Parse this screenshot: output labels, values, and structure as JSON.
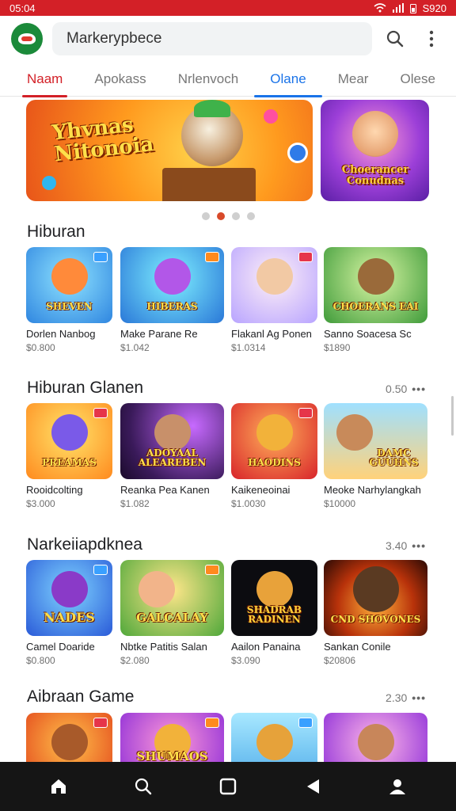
{
  "status": {
    "time": "05:04",
    "right": "S920"
  },
  "header": {
    "search_text": "Markerypbece"
  },
  "tabs": [
    "Naam",
    "Apokass",
    "Nrlenvoch",
    "Olane",
    "Mear",
    "Olese"
  ],
  "banners": {
    "main_text": "Yhvnas Nitonoia",
    "side_text": "Choerancer Conudnas"
  },
  "sections": [
    {
      "title": "Hiburan",
      "more": "",
      "items": [
        {
          "label": "SHEVEN",
          "name": "Dorlen Nanbog",
          "price": "$0.800"
        },
        {
          "label": "HIBERAS",
          "name": "Make Parane Re",
          "price": "$1.042"
        },
        {
          "label": "",
          "name": "Flakanl Ag Ponen",
          "price": "$1.0314"
        },
        {
          "label": "CHOERANS EAI",
          "name": "Sanno Soacesa Sc",
          "price": "$1890"
        }
      ]
    },
    {
      "title": "Hiburan Glanen",
      "more": "0.50",
      "items": [
        {
          "label": "PREAMAS",
          "name": "Rooidcolting",
          "price": "$3.000"
        },
        {
          "label": "ADOYAAL ALEAREBEN",
          "name": "Reanka Pea Kanen",
          "price": "$1.082"
        },
        {
          "label": "HAODINS",
          "name": "Kaikeneoinai",
          "price": "$1.0030"
        },
        {
          "label": "DAMC GUUHNS",
          "name": "Meoke Narhylangkah",
          "price": "$10000"
        }
      ]
    },
    {
      "title": "Narkeiiapdknea",
      "more": "3.40",
      "items": [
        {
          "label": "NADES",
          "name": "Camel Doaride",
          "price": "$0.800"
        },
        {
          "label": "GALCALAY",
          "name": "Nbtke Patitis Salan",
          "price": "$2.080"
        },
        {
          "label": "SHADRAB RADINEN",
          "name": "Aailon Panaina",
          "price": "$3.090"
        },
        {
          "label": "CND SHOVONES",
          "name": "Sankan Conile",
          "price": "$20806"
        }
      ]
    },
    {
      "title": "Aibraan Game",
      "more": "2.30",
      "items": [
        {
          "label": "",
          "name": "",
          "price": ""
        },
        {
          "label": "SHUMAOS",
          "name": "",
          "price": ""
        },
        {
          "label": "",
          "name": "",
          "price": ""
        },
        {
          "label": "",
          "name": "",
          "price": ""
        }
      ]
    }
  ],
  "colors": {
    "status_bar": "#d32027",
    "accent_red": "#d32027",
    "accent_blue": "#1a73e8",
    "nav_bar": "#151515"
  },
  "icons": {
    "nav": [
      "home-icon",
      "search-icon",
      "square-icon",
      "back-icon",
      "profile-icon"
    ]
  }
}
